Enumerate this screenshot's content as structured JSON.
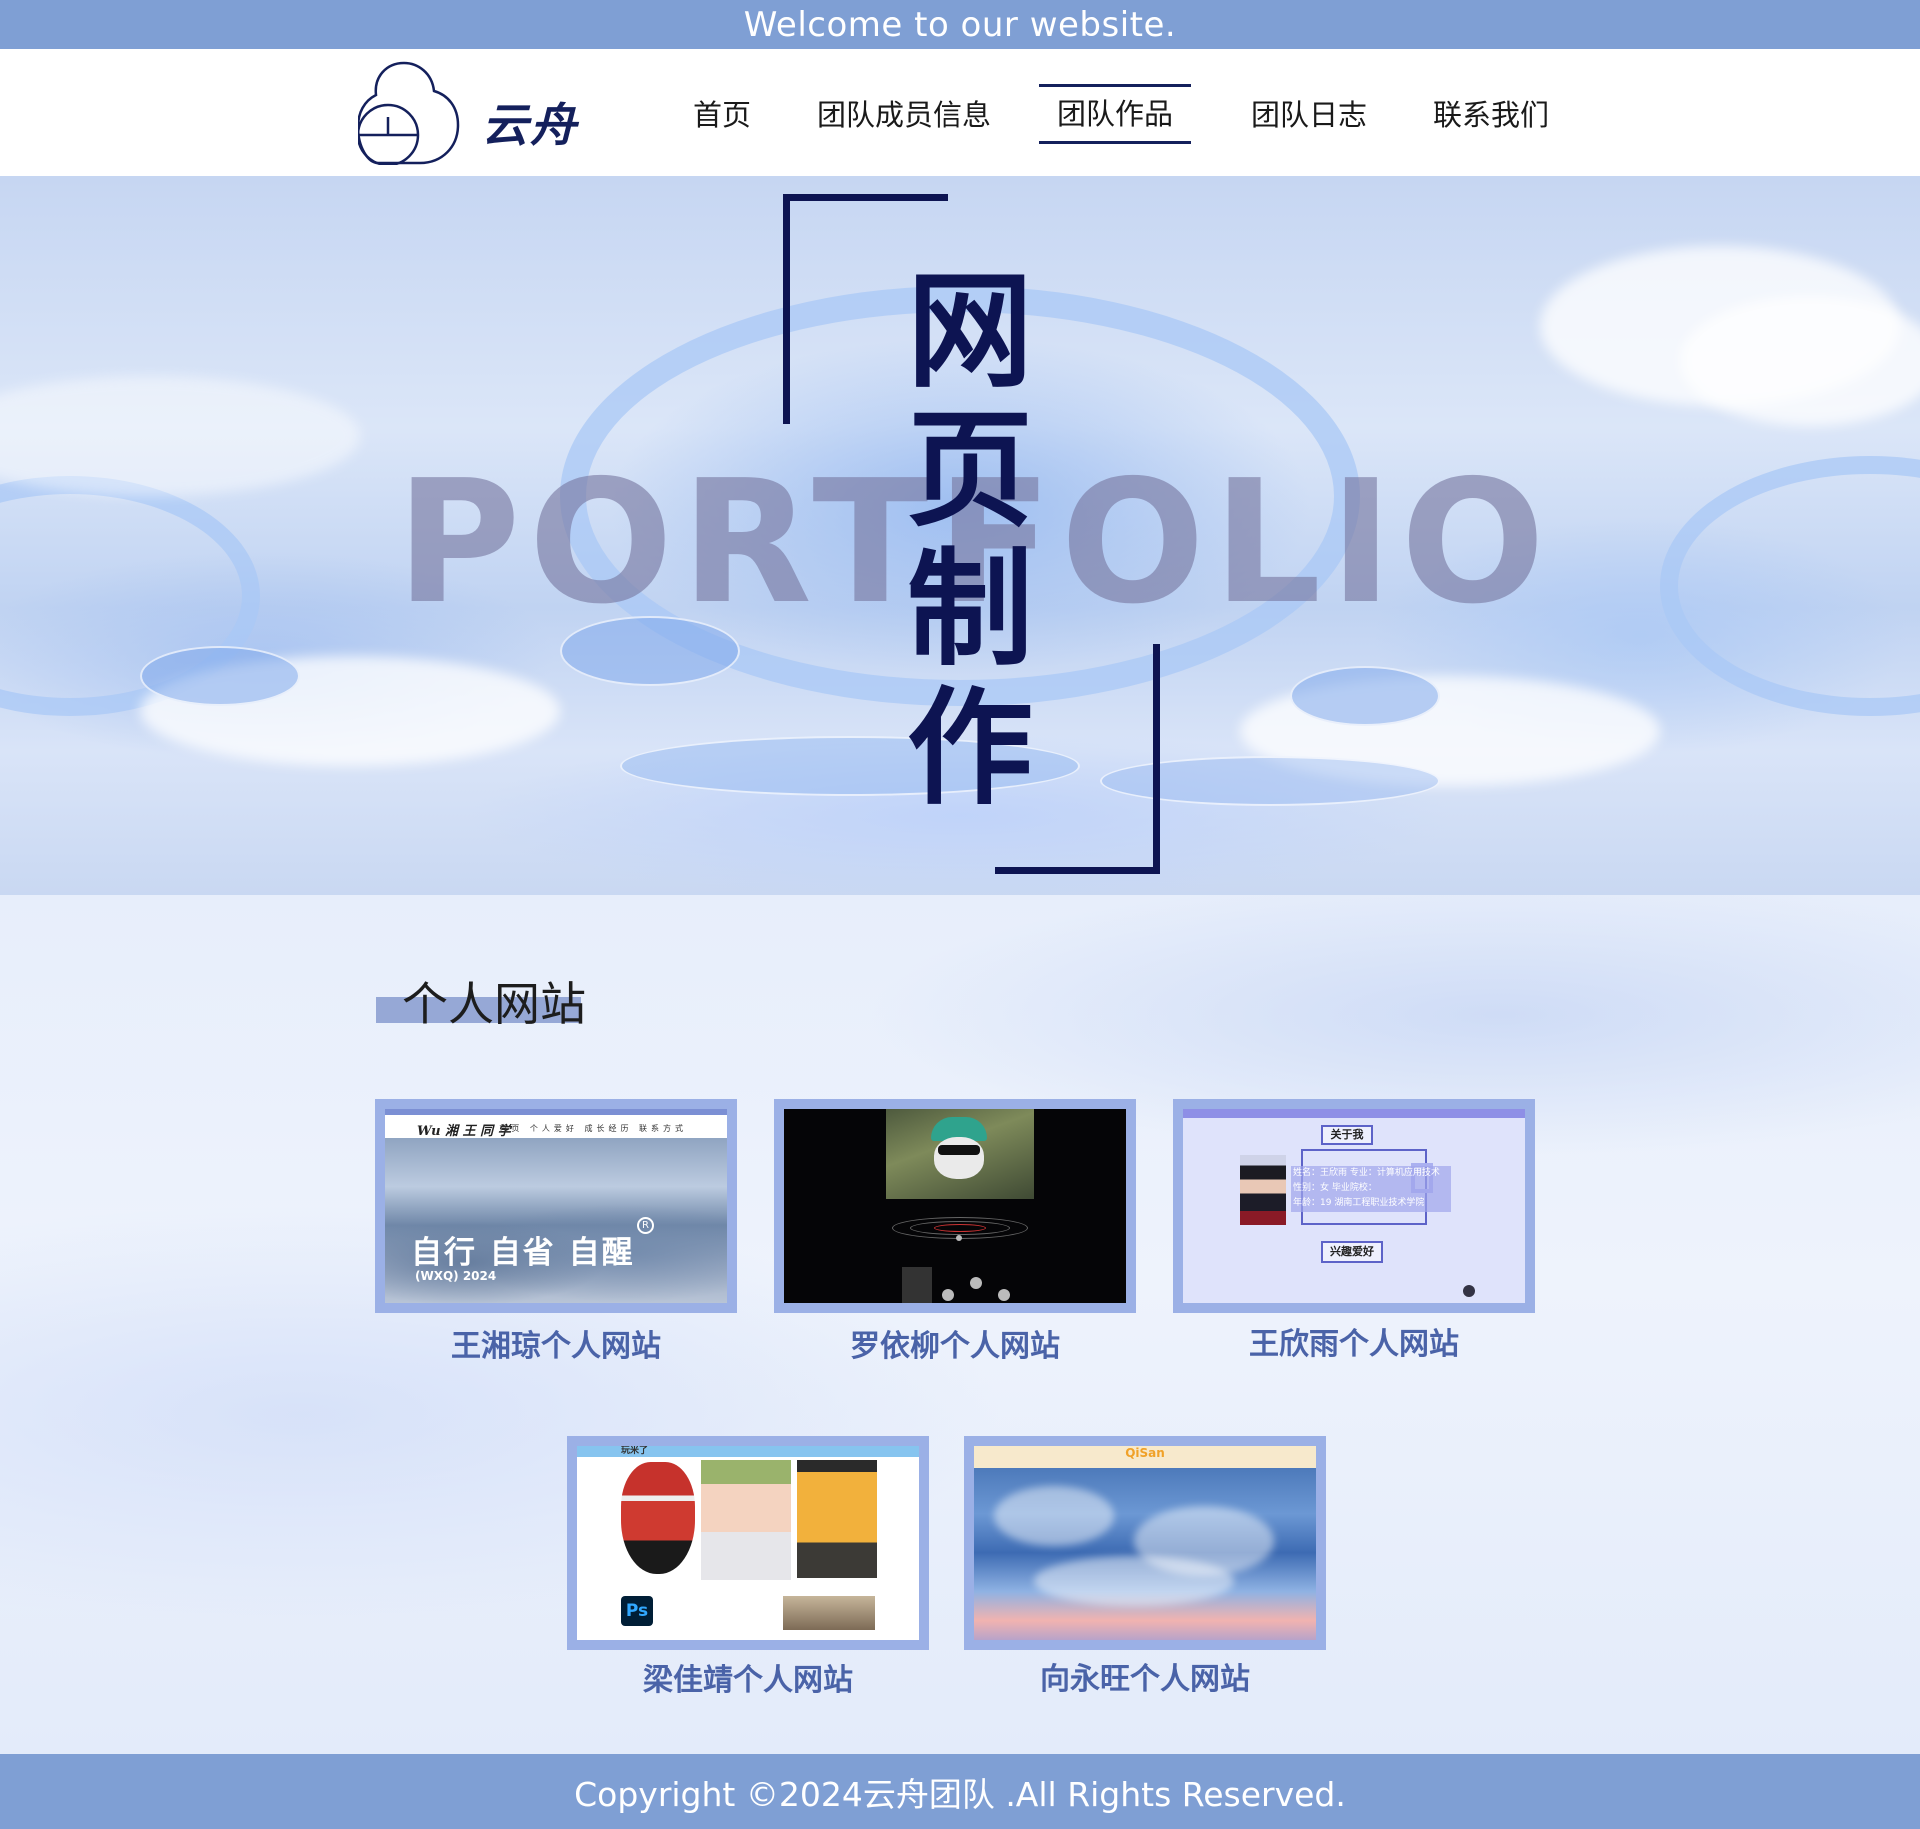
{
  "topbar": {
    "welcome": "Welcome to our website."
  },
  "header": {
    "logo_text": "云舟",
    "nav": [
      "首页",
      "团队成员信息",
      "团队作品",
      "团队日志",
      "联系我们"
    ],
    "active_index": 2
  },
  "hero": {
    "bg_word": "PORTFOLIO",
    "title_chars": [
      "网",
      "页",
      "制",
      "作"
    ]
  },
  "section": {
    "title": "个人网站"
  },
  "cards": [
    {
      "label": "王湘琼个人网站"
    },
    {
      "label": "罗依柳个人网站"
    },
    {
      "label": "王欣雨个人网站"
    },
    {
      "label": "梁佳靖个人网站"
    },
    {
      "label": "向永旺个人网站"
    }
  ],
  "shot1": {
    "brand": "Wu 湘 王 同 学",
    "links": "首页 个人爱好 成长经历 联系方式",
    "slogan": "自行 自省 自醒",
    "year": "(WXQ) 2024",
    "reg": "R"
  },
  "shot3": {
    "about": "关于我",
    "hobby": "兴趣爱好",
    "info_line1": "姓名：王欣雨 专业：计算机应用技术",
    "info_line2": "性别：女  毕业院校：",
    "info_line3": "年龄：19  湖南工程职业技术学院"
  },
  "shot4": {
    "brand": "玩米了",
    "ps": "Ps"
  },
  "shot5": {
    "brand": "QiSan"
  },
  "footer": {
    "copyright": "Copyright ©2024云舟团队 .All Rights Reserved."
  },
  "colors": {
    "bar": "#7f9fd4",
    "navy": "#0d1452",
    "card_border": "#9bb0e6",
    "label": "#4a63a8"
  }
}
